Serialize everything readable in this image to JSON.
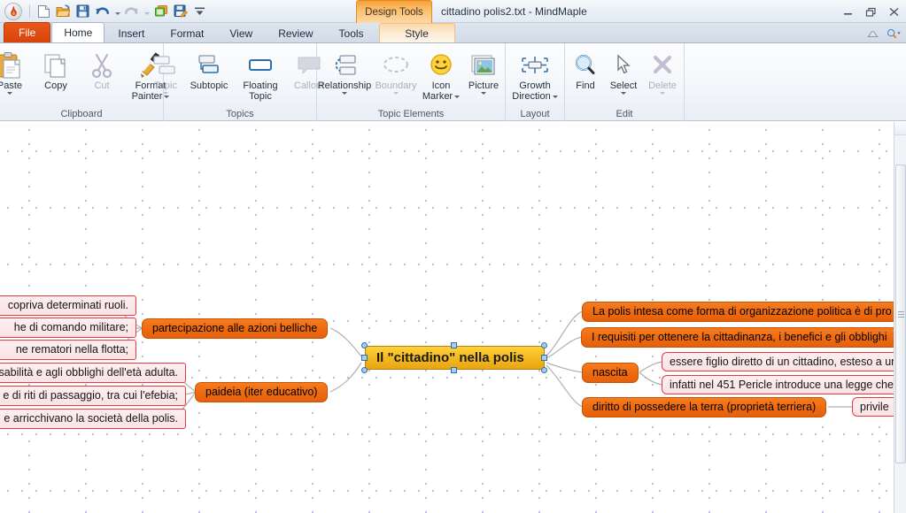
{
  "window": {
    "title": "cittadino polis2.txt - MindMaple",
    "contextual_tab": "Design Tools",
    "controls": {
      "minimize": "–",
      "restore": "❐",
      "close": "✕"
    }
  },
  "quick_access": {
    "app_button": "app-menu",
    "items": [
      {
        "name": "new-icon",
        "glyph": "new"
      },
      {
        "name": "open-icon",
        "glyph": "open"
      },
      {
        "name": "save-icon",
        "glyph": "save"
      },
      {
        "name": "undo-icon",
        "glyph": "undo"
      },
      {
        "name": "undo-dropdown",
        "glyph": "caret"
      },
      {
        "name": "redo-icon",
        "glyph": "redo"
      },
      {
        "name": "redo-dropdown",
        "glyph": "caret-dim"
      },
      {
        "name": "copy-window-icon",
        "glyph": "copywin"
      },
      {
        "name": "save-as-icon",
        "glyph": "saveas"
      },
      {
        "name": "customize-qat-icon",
        "glyph": "qatmenu"
      }
    ]
  },
  "tabs": [
    {
      "label": "File",
      "style": "file"
    },
    {
      "label": "Home",
      "style": "active"
    },
    {
      "label": "Insert",
      "style": "normal"
    },
    {
      "label": "Format",
      "style": "normal"
    },
    {
      "label": "View",
      "style": "normal"
    },
    {
      "label": "Review",
      "style": "normal"
    },
    {
      "label": "Tools",
      "style": "normal"
    },
    {
      "label": "Style",
      "style": "contextual"
    }
  ],
  "tab_right": {
    "help": "help-icon",
    "find_zoom": "search-icon"
  },
  "ribbon": {
    "groups": [
      {
        "label": "Clipboard",
        "items": [
          {
            "label": "Paste",
            "icon": "paste-icon",
            "disabled": false,
            "caret": true
          },
          {
            "label": "Copy",
            "icon": "copy-icon",
            "disabled": false,
            "caret": false
          },
          {
            "label": "Cut",
            "icon": "cut-icon",
            "disabled": true,
            "caret": false
          },
          {
            "label": "Format Painter",
            "icon": "format-painter-icon",
            "disabled": false,
            "caret": "inline"
          }
        ]
      },
      {
        "label": "Topics",
        "items": [
          {
            "label": "Topic",
            "icon": "topic-icon",
            "disabled": true,
            "caret": true
          },
          {
            "label": "Subtopic",
            "icon": "subtopic-icon",
            "disabled": false,
            "caret": false
          },
          {
            "label": "Floating Topic",
            "icon": "floating-topic-icon",
            "disabled": false,
            "caret": false
          },
          {
            "label": "Callout",
            "icon": "callout-icon",
            "disabled": true,
            "caret": false
          }
        ]
      },
      {
        "label": "Topic Elements",
        "items": [
          {
            "label": "Relationship",
            "icon": "relationship-icon",
            "disabled": false,
            "caret": true
          },
          {
            "label": "Boundary",
            "icon": "boundary-icon",
            "disabled": true,
            "caret": true
          },
          {
            "label": "Icon Marker",
            "icon": "icon-marker-icon",
            "disabled": false,
            "caret": "inline"
          },
          {
            "label": "Picture",
            "icon": "picture-icon",
            "disabled": false,
            "caret": true
          }
        ]
      },
      {
        "label": "Layout",
        "items": [
          {
            "label": "Growth Direction",
            "icon": "growth-direction-icon",
            "disabled": false,
            "caret": "inline"
          }
        ]
      },
      {
        "label": "Edit",
        "items": [
          {
            "label": "Find",
            "icon": "find-icon",
            "disabled": false,
            "caret": false
          },
          {
            "label": "Select",
            "icon": "select-icon",
            "disabled": false,
            "caret": true
          },
          {
            "label": "Delete",
            "icon": "delete-icon",
            "disabled": true,
            "caret": true
          }
        ]
      }
    ]
  },
  "mindmap": {
    "central": {
      "text": "Il \"cittadino\" nella polis",
      "selected": true
    },
    "left_main": [
      {
        "text": "partecipazione alle azioni belliche"
      },
      {
        "text": "paideia (iter educativo)"
      }
    ],
    "left_sub": [
      {
        "text": "copriva determinati ruoli."
      },
      {
        "text": "he di comando militare;"
      },
      {
        "text": "ne rematori nella flotta;"
      },
      {
        "text": "sabilità e agli obblighi dell'età adulta."
      },
      {
        "text": "e di riti di passaggio, tra cui l'efebia;"
      },
      {
        "text": "e arricchivano la società della polis."
      }
    ],
    "right_main": [
      {
        "text": "La polis intesa come forma di organizzazione politica è di pro"
      },
      {
        "text": "I requisiti per ottenere la cittadinanza, i benefici e gli obblighi"
      },
      {
        "text": "nascita"
      },
      {
        "text": "diritto di possedere la terra (proprietà terriera)"
      }
    ],
    "right_sub": [
      {
        "text": "essere figlio diretto di un cittadino, esteso a una"
      },
      {
        "text": "infatti nel 451 Pericle introduce una legge che li"
      },
      {
        "text": "privile"
      }
    ]
  },
  "scrollbar": {
    "name": "vertical-scrollbar",
    "up_arrow": "▲"
  },
  "colors": {
    "accent_orange": "#ee6a10",
    "central_yellow": "#f5b81f",
    "sub_border_red": "#e8393f",
    "file_tab": "#d8430c",
    "grid_dot": "#7a7fc4"
  }
}
